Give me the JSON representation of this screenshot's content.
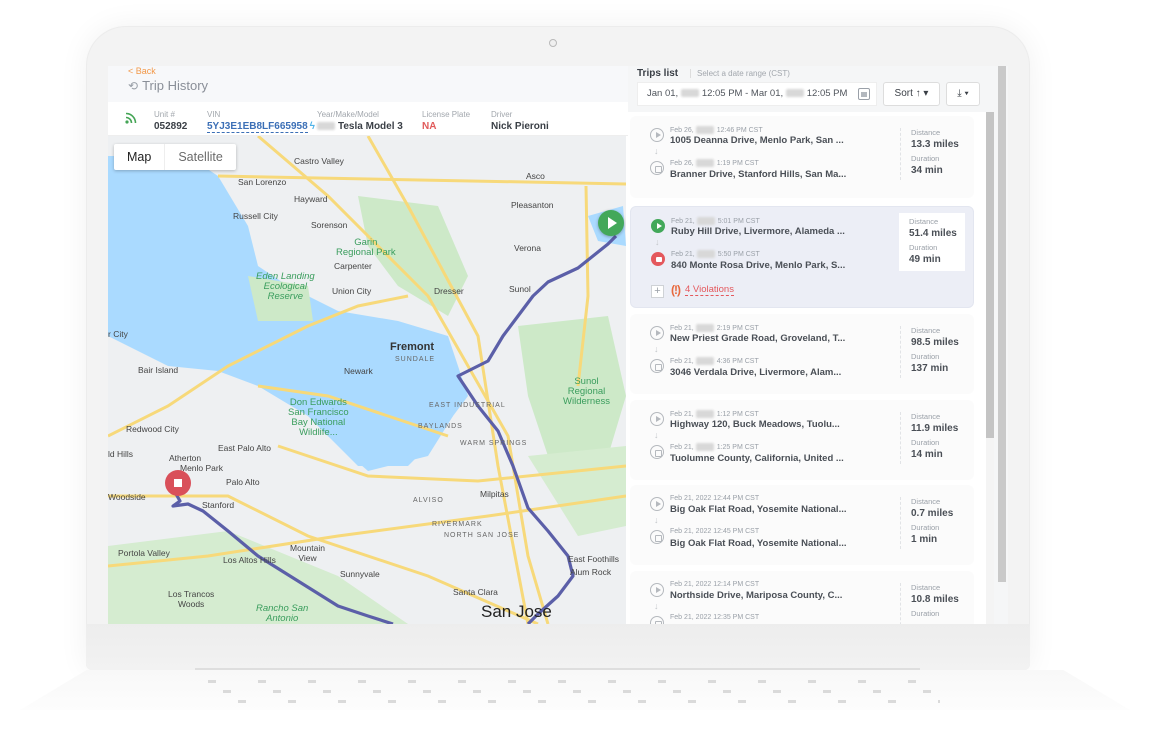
{
  "header": {
    "back_label": "< Back",
    "title": "Trip History",
    "history_icon": "history-icon"
  },
  "vehicle": {
    "status_icon": "signal-icon",
    "unit_label": "Unit #",
    "unit_value": "052892",
    "vin_label": "VIN",
    "vin_value": "5YJ3E1EB8LF665958",
    "vin_icon": "bolt-icon",
    "ymm_label": "Year/Make/Model",
    "ymm_value": "Tesla Model 3",
    "plate_label": "License Plate",
    "plate_value": "NA",
    "driver_label": "Driver",
    "driver_value": "Nick Pieroni"
  },
  "map": {
    "toggle": [
      "Map",
      "Satellite"
    ],
    "active_view": "Map",
    "route_color": "#5b5fa8",
    "labels": {
      "castro_valley": "Castro Valley",
      "san_lorenzo": "San Lorenzo",
      "hayward": "Hayward",
      "russell_city": "Russell City",
      "sorenson": "Sorenson",
      "garin": "Garin\nRegional Park",
      "carpenter": "Carpenter",
      "eden": "Eden Landing\nEcological\nReserve",
      "union_city": "Union City",
      "dresser": "Dresser",
      "sunol": "Sunol",
      "verona": "Verona",
      "pleasanton": "Pleasanton",
      "asco": "Asco",
      "fremont": "Fremont",
      "sundale": "SUNDALE",
      "newark": "Newark",
      "foster_city": "r City",
      "bair_island": "Bair Island",
      "don_edwards": "Don Edwards\nSan Francisco\nBay National\nWildlife...",
      "sunol_wild": "Sunol\nRegional\nWilderness",
      "east_industrial": "EAST INDUSTRIAL",
      "baylands": "BAYLANDS",
      "warm_springs": "WARM SPRINGS",
      "redwood_city": "Redwood City",
      "east_palo_alto": "East Palo Alto",
      "atherton": "Atherton",
      "menlo_park": "Menlo Park",
      "palo_alto": "Palo Alto",
      "woodside": "Woodside",
      "stanford": "Stanford",
      "ld_hills": "ld Hills",
      "alviso": "ALVISO",
      "milpitas": "Milpitas",
      "rivermark": "RIVERMARK",
      "north_san_jose": "NORTH SAN JOSE",
      "east_foothills": "East Foothills",
      "alum_rock": "Alum Rock",
      "portola_valley": "Portola Valley",
      "los_altos_hills": "Los Altos Hills",
      "mountain_view": "Mountain\nView",
      "sunnyvale": "Sunnyvale",
      "santa_clara": "Santa Clara",
      "san_jose": "San Jose",
      "los_trancos": "Los Trancos\nWoods",
      "rancho": "Rancho San\nAntonio"
    },
    "start_marker": "play-icon",
    "end_marker": "stop-icon"
  },
  "trips_panel": {
    "title": "Trips list",
    "subtitle": "Select a date range (CST)",
    "date_from": "Jan 01,",
    "date_from_time": "12:05 PM - Mar 01,",
    "date_to_time": "12:05 PM",
    "calendar_icon": "calendar-icon",
    "sort_label": "Sort ↑ ▾",
    "download_label": "⤓ ▾",
    "distance_label": "Distance",
    "duration_label": "Duration",
    "trips": [
      {
        "start_date": "Feb 26,",
        "start_time": "12:46 PM CST",
        "start_addr": "1005 Deanna Drive, Menlo Park, San ...",
        "end_date": "Feb 26,",
        "end_time": "1:19 PM CST",
        "end_addr": "Branner Drive, Stanford Hills, San Ma...",
        "distance": "13.3 miles",
        "duration": "34 min"
      },
      {
        "start_date": "Feb 21,",
        "start_time": "5:01 PM CST",
        "start_addr": "Ruby Hill Drive, Livermore, Alameda ...",
        "end_date": "Feb 21,",
        "end_time": "5:50 PM CST",
        "end_addr": "840 Monte Rosa Drive, Menlo Park, S...",
        "distance": "51.4 miles",
        "duration": "49 min",
        "selected": true,
        "violations": "4 Violations"
      },
      {
        "start_date": "Feb 21,",
        "start_time": "2:19 PM CST",
        "start_addr": "New Priest Grade Road, Groveland, T...",
        "end_date": "Feb 21,",
        "end_time": "4:36 PM CST",
        "end_addr": "3046 Verdala Drive, Livermore, Alam...",
        "distance": "98.5 miles",
        "duration": "137 min"
      },
      {
        "start_date": "Feb 21,",
        "start_time": "1:12 PM CST",
        "start_addr": "Highway 120, Buck Meadows, Tuolu...",
        "end_date": "Feb 21,",
        "end_time": "1:25 PM CST",
        "end_addr": "Tuolumne County, California, United ...",
        "distance": "11.9 miles",
        "duration": "14 min"
      },
      {
        "start_date": "Feb 21, 2022",
        "start_time": "12:44 PM CST",
        "start_addr": "Big Oak Flat Road, Yosemite National...",
        "end_date": "Feb 21, 2022",
        "end_time": "12:45 PM CST",
        "end_addr": "Big Oak Flat Road, Yosemite National...",
        "distance": "0.7 miles",
        "duration": "1 min"
      },
      {
        "start_date": "Feb 21, 2022",
        "start_time": "12:14 PM CST",
        "start_addr": "Northside Drive, Mariposa County, C...",
        "end_date": "Feb 21, 2022",
        "end_time": "12:35 PM CST",
        "end_addr": "",
        "distance": "10.8 miles",
        "duration": ""
      }
    ]
  }
}
